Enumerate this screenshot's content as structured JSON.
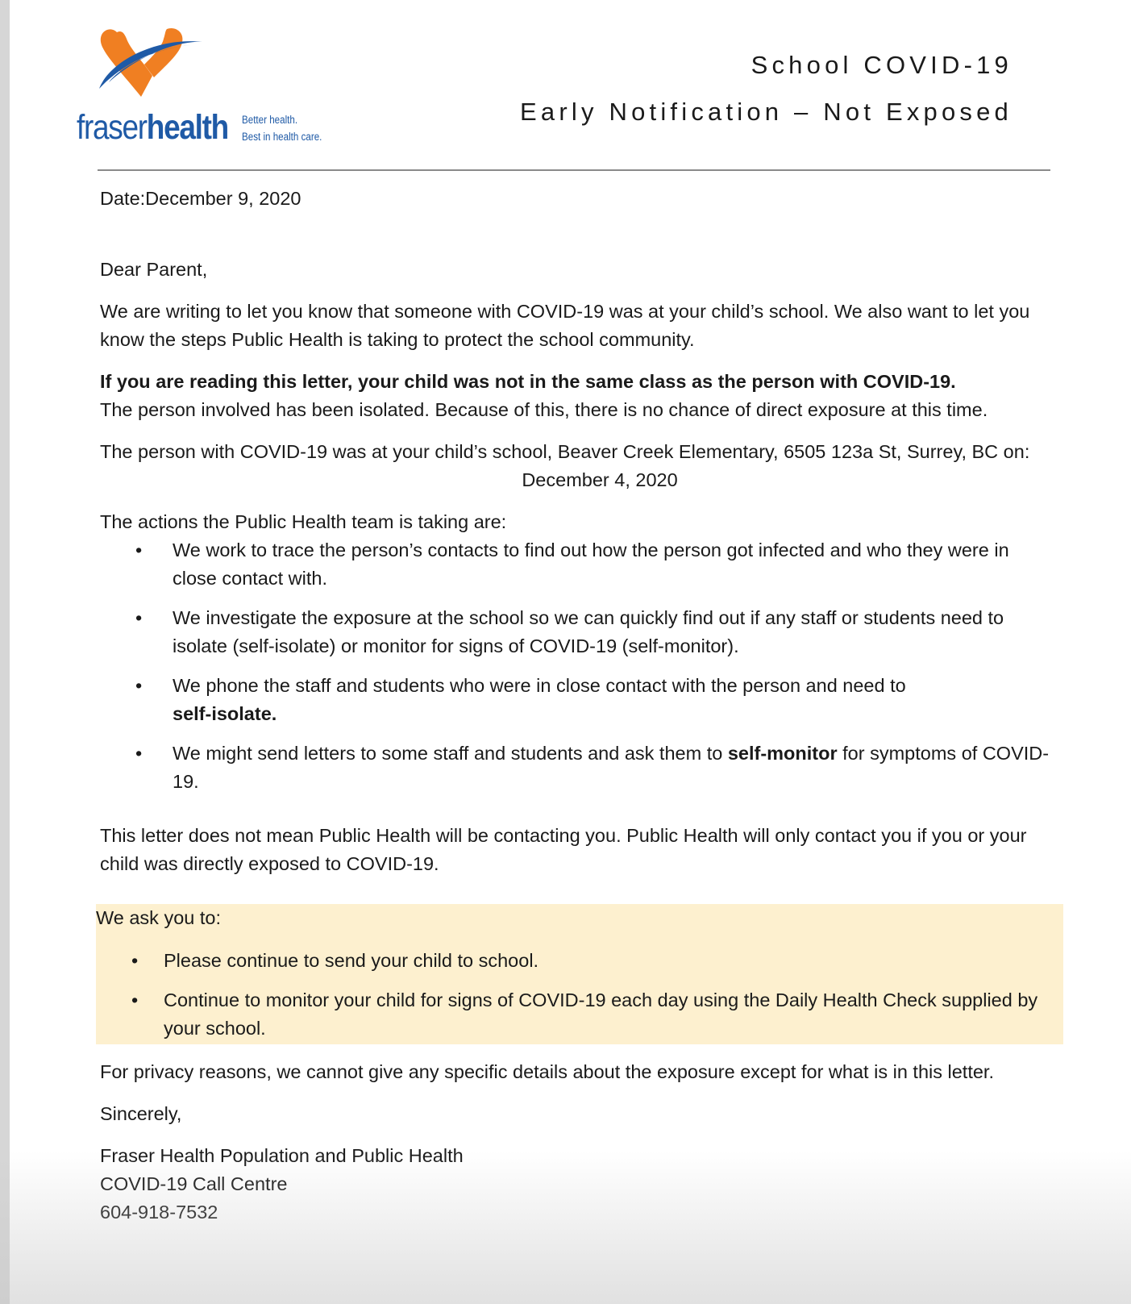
{
  "colors": {
    "brand_blue": "#1f5aa6",
    "brand_orange": "#f07f22",
    "highlight": "#fdf0cf"
  },
  "logo": {
    "word_light": "fraser",
    "word_bold": "health",
    "tagline_1": "Better health.",
    "tagline_2": "Best in health care."
  },
  "title": {
    "line_1": "School COVID-19",
    "line_2": "Early Notification – Not Exposed"
  },
  "letter": {
    "date": "Date:December 9, 2020",
    "salutation": "Dear Parent,",
    "intro": "We are writing to let you know that someone with COVID-19 was at your child’s school. We also want to let you know the steps Public Health is taking to protect the school community.",
    "not_same_class_bold": "If you are reading this letter, your child was not in the same class as the person with COVID-19.",
    "not_same_class_rest": "The person involved has been isolated. Because of this, there is no chance of direct exposure at this time.",
    "location": "The person with COVID-19 was at your child’s school, Beaver Creek Elementary, 6505 123a St, Surrey, BC on:",
    "exposure_date": "December 4, 2020",
    "actions_heading": "The actions the Public Health team is taking are:",
    "bullet": "•",
    "actions": [
      {
        "text": "We work to trace the person’s contacts to find out how the person got infected and who they were in close contact with."
      },
      {
        "text": "We investigate the exposure at the school so we can quickly find out if any staff or students need to isolate (self-isolate) or monitor for signs of COVID-19 (self-monitor)."
      },
      {
        "text_before": "We phone the staff and students who were in close contact with the person and need to",
        "bold": "self-isolate."
      },
      {
        "text_before": "We might send letters to some staff and students and ask them to",
        "bold": "self-monitor",
        "text_after": "for symptoms of COVID-19."
      }
    ],
    "no_contact": "This letter does not mean Public Health will be contacting you. Public Health will only contact you if you or your child was directly exposed to COVID-19.",
    "ask_heading": "We ask you to:",
    "ask_items": [
      "Please continue to send your child to school.",
      "Continue to monitor your child for signs of COVID-19 each day using the Daily Health Check supplied by your school."
    ],
    "privacy": "For privacy reasons, we cannot give any specific details about the exposure except for what is in this letter.",
    "closing": "Sincerely,",
    "signature": [
      "Fraser Health Population and Public Health",
      "COVID-19 Call Centre",
      "604-918-7532"
    ]
  }
}
